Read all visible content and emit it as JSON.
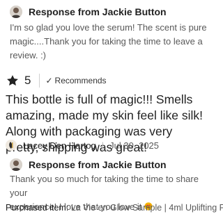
{
  "response1": {
    "title": "Response from Jackie Button",
    "text": "I'm so glad you love the serum! The scent is pure magic....Thank you for taking the time to leave a review. :)"
  },
  "review": {
    "rating": "5",
    "recommends_label": "Recommends",
    "text": "This bottle is full of magic!!! Smells amazing, made my skin feel like silk! Along with packaging was very pretty, shipping was great!",
    "reviewer_name": "Lacey Den Hartog",
    "date": "Jul 30, 2025"
  },
  "response2": {
    "title": "Response from Jackie Button",
    "text_line1": "Thank you so much for taking the time to share your",
    "text_line2": "experience! I love that you love it"
  },
  "purchased": {
    "label": "Purchased item:",
    "value": "La Vie en Glow Sample | 4ml Uplifting F..."
  },
  "colors": {
    "star": "#222222",
    "muted_text": "#595959",
    "divider": "#cfcfcf"
  },
  "icons": [
    "seller-avatar",
    "star-icon",
    "check-icon",
    "reviewer-avatar",
    "heart-eyes-emoji"
  ]
}
